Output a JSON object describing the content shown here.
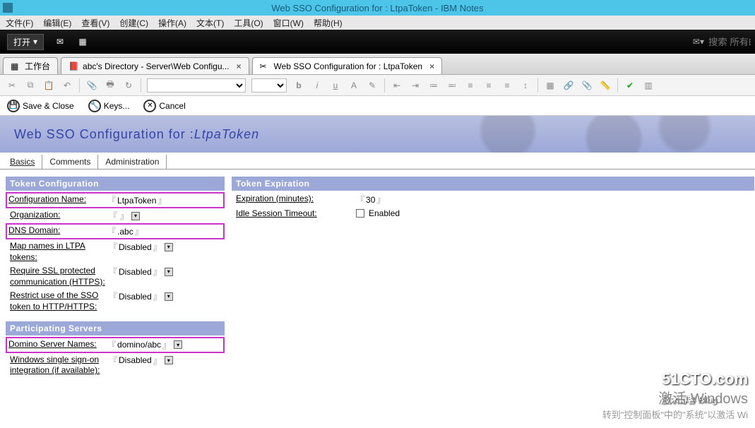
{
  "window": {
    "title": "Web SSO Configuration for : LtpaToken - IBM Notes"
  },
  "menu": {
    "items": [
      "文件(F)",
      "编辑(E)",
      "查看(V)",
      "创建(C)",
      "操作(A)",
      "文本(T)",
      "工具(O)",
      "窗口(W)",
      "帮助(H)"
    ]
  },
  "toolbar": {
    "open": "打开",
    "search_placeholder": "搜索 所有邮"
  },
  "tabs": {
    "t0": "工作台",
    "t1": "abc's Directory - Server\\Web Configu...",
    "t2": "Web SSO Configuration for : LtpaToken"
  },
  "action": {
    "save": "Save & Close",
    "keys": "Keys...",
    "cancel": "Cancel"
  },
  "banner": {
    "prefix": "Web SSO Configuration for : ",
    "name": "LtpaToken"
  },
  "formtabs": {
    "t0": "Basics",
    "t1": "Comments",
    "t2": "Administration"
  },
  "section": {
    "tokcfg": "Token Configuration",
    "tokexp": "Token Expiration",
    "parts": "Participating Servers"
  },
  "fields": {
    "cfgname_lbl": "Configuration Name:",
    "cfgname": "LtpaToken",
    "org_lbl": "Organization:",
    "org": "",
    "dns_lbl": "DNS Domain:",
    "dns": ".abc",
    "map_lbl": "Map names in LTPA tokens:",
    "map": "Disabled",
    "ssl_lbl": "Require SSL protected communication (HTTPS):",
    "ssl": "Disabled",
    "restrict_lbl": "Restrict use of the SSO token to HTTP/HTTPS:",
    "restrict": "Disabled",
    "dsn_lbl": "Domino Server Names:",
    "dsn": "domino/abc",
    "wsso_lbl": "Windows single sign-on integration (if available):",
    "wsso": "Disabled",
    "exp_lbl": "Expiration (minutes):",
    "exp": "30",
    "idle_lbl": "Idle Session Timeout:",
    "idle": "Enabled"
  },
  "watermark": {
    "l1": "激活 Windows",
    "l2": "转到\"控制面板\"中的\"系统\"以激活 Wi",
    "logo": "51CTO.com",
    "sub": "技术博客   Blog"
  }
}
